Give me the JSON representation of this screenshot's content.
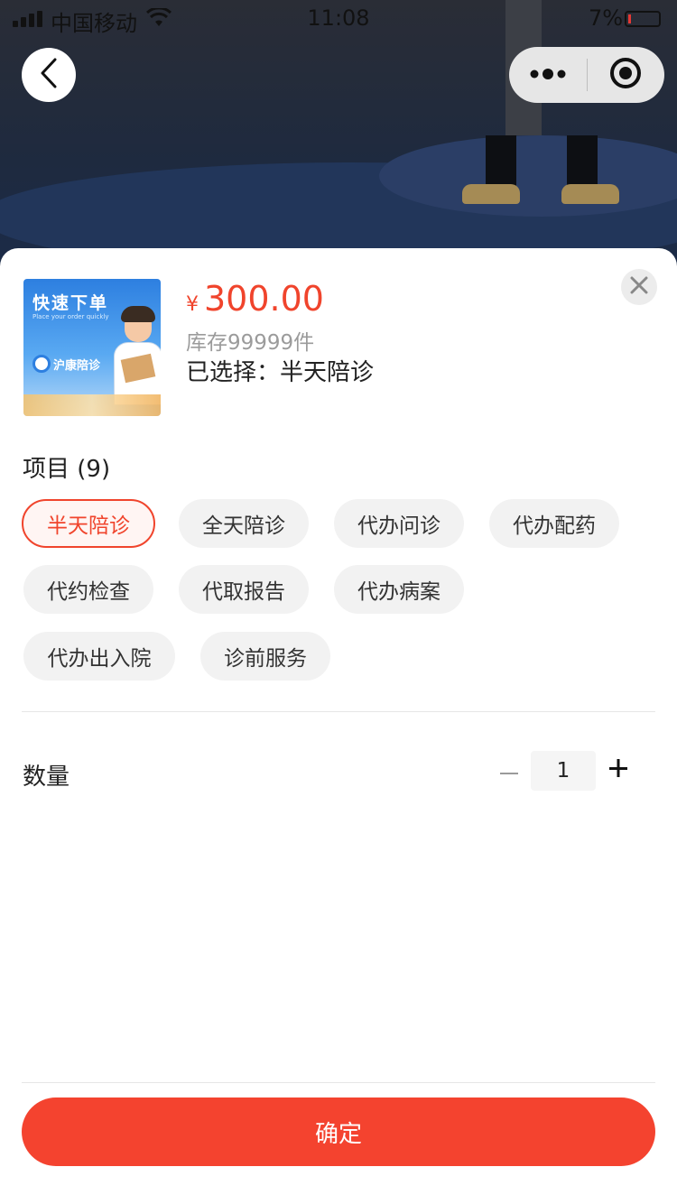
{
  "status_bar": {
    "carrier": "中国移动",
    "time": "11:08",
    "battery_percent": "7%"
  },
  "nav": {
    "back_icon": "chevron-left-icon",
    "more_icon": "more-dots-icon",
    "target_icon": "target-icon"
  },
  "product": {
    "image_title": "快速下单",
    "image_subtitle": "Place your order quickly",
    "image_brand": "沪康陪诊",
    "currency_symbol": "¥",
    "price": "300.00",
    "stock": "库存99999件",
    "selected": "已选择：半天陪诊"
  },
  "options": {
    "title": "项目 (9)",
    "items": [
      {
        "label": "半天陪诊",
        "active": true
      },
      {
        "label": "全天陪诊",
        "active": false
      },
      {
        "label": "代办问诊",
        "active": false
      },
      {
        "label": "代办配药",
        "active": false
      },
      {
        "label": "代约检查",
        "active": false
      },
      {
        "label": "代取报告",
        "active": false
      },
      {
        "label": "代办病案",
        "active": false
      },
      {
        "label": "代办出入院",
        "active": false
      },
      {
        "label": "诊前服务",
        "active": false
      }
    ]
  },
  "quantity": {
    "label": "数量",
    "value": "1"
  },
  "confirm_label": "确定",
  "colors": {
    "accent": "#f0442c",
    "button": "#f4432f"
  }
}
